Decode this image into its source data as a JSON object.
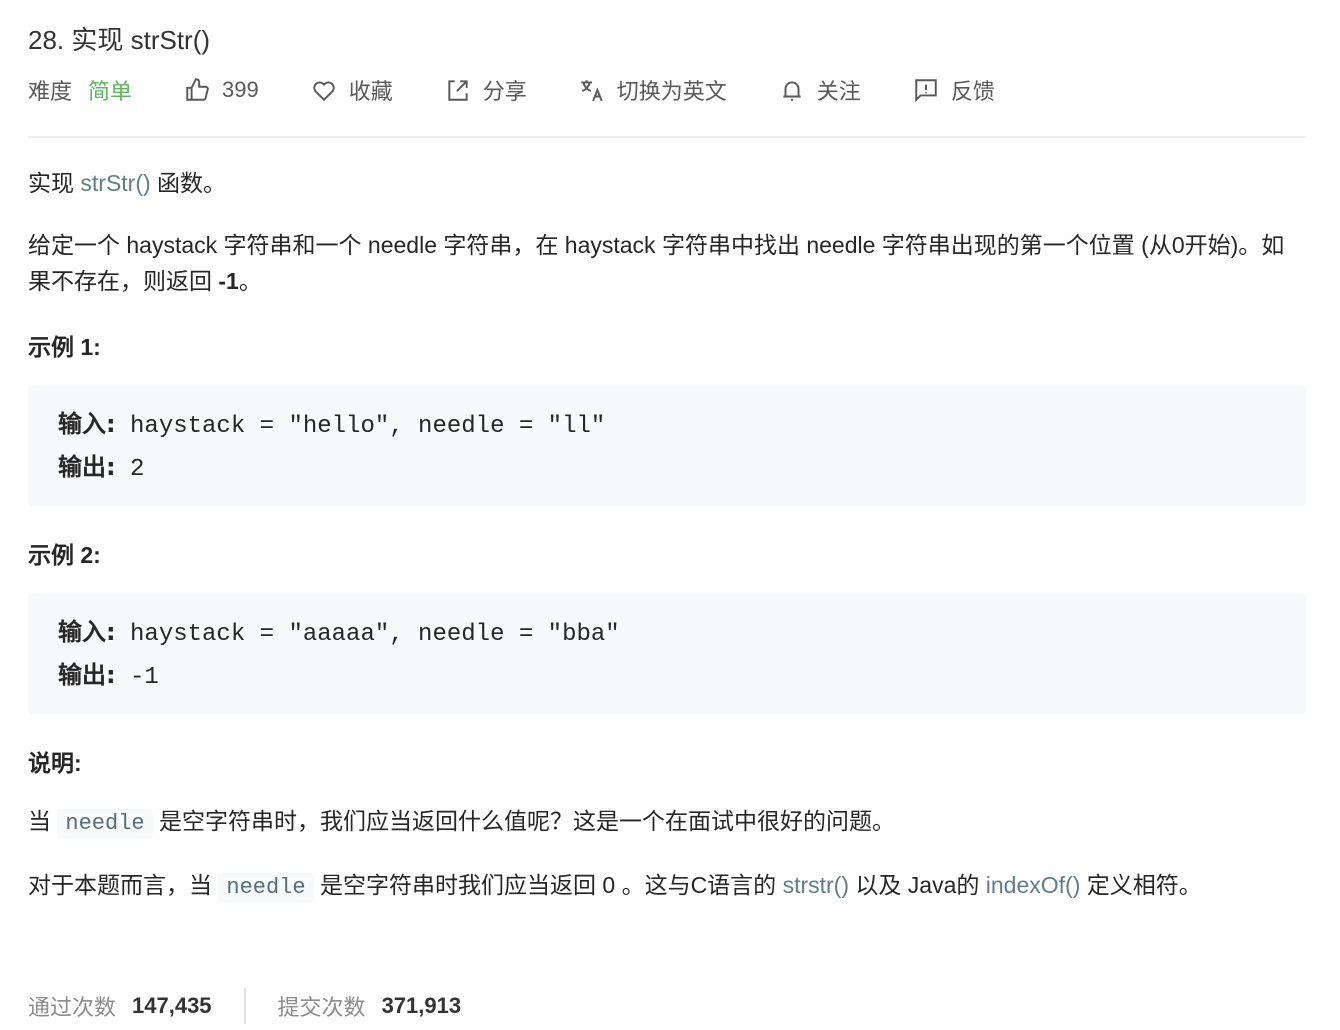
{
  "title": "28. 实现 strStr()",
  "meta": {
    "difficulty_label": "难度",
    "difficulty": "简单",
    "likes": "399",
    "favorite": "收藏",
    "share": "分享",
    "switch_lang": "切换为英文",
    "follow": "关注",
    "feedback": "反馈"
  },
  "desc": {
    "p1_a": "实现 ",
    "p1_link": "strStr()",
    "p1_b": " 函数。",
    "p2": "给定一个 haystack 字符串和一个 needle 字符串，在 haystack 字符串中找出 needle 字符串出现的第一个位置 (从0开始)。如果不存在，则返回 ",
    "p2_bold": "-1",
    "p2_end": "。"
  },
  "examples": [
    {
      "heading": "示例 1:",
      "input_label": "输入:",
      "input": " haystack = \"hello\", needle = \"ll\"",
      "output_label": "输出:",
      "output": " 2"
    },
    {
      "heading": "示例 2:",
      "input_label": "输入:",
      "input": " haystack = \"aaaaa\", needle = \"bba\"",
      "output_label": "输出:",
      "output": " -1"
    }
  ],
  "note": {
    "heading": "说明:",
    "l1_a": "当 ",
    "code": "needle",
    "l1_b": " 是空字符串时，我们应当返回什么值呢？这是一个在面试中很好的问题。",
    "l2_a": "对于本题而言，当 ",
    "l2_b": " 是空字符串时我们应当返回 0 。这与C语言的 ",
    "link1": "strstr()",
    "l2_c": " 以及 Java的 ",
    "link2": "indexOf()",
    "l2_d": " 定义相符。"
  },
  "stats": {
    "accepted_label": "通过次数",
    "accepted": "147,435",
    "submissions_label": "提交次数",
    "submissions": "371,913"
  }
}
